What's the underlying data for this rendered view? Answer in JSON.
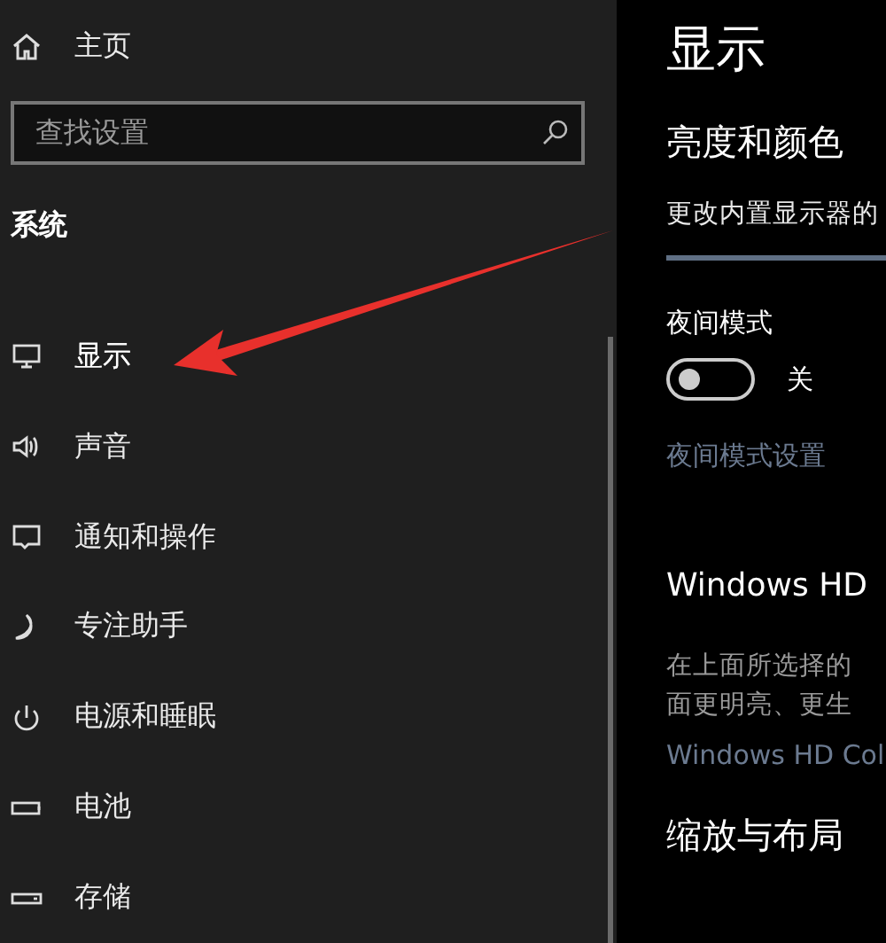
{
  "sidebar": {
    "home": {
      "label": "主页"
    },
    "search": {
      "placeholder": "查找设置"
    },
    "section_title": "系统",
    "items": [
      {
        "label": "显示",
        "selected": true
      },
      {
        "label": "声音",
        "selected": false
      },
      {
        "label": "通知和操作",
        "selected": false
      },
      {
        "label": "专注助手",
        "selected": false
      },
      {
        "label": "电源和睡眠",
        "selected": false
      },
      {
        "label": "电池",
        "selected": false
      },
      {
        "label": "存储",
        "selected": false
      }
    ]
  },
  "content": {
    "title": "显示",
    "brightness": {
      "heading": "亮度和颜色",
      "description": "更改内置显示器的"
    },
    "night_light": {
      "label": "夜间模式",
      "on": false,
      "state_text": "关",
      "settings_link": "夜间模式设置"
    },
    "hd_color": {
      "heading": "Windows HD",
      "description": [
        "在上面所选择的",
        "面更明亮、更生"
      ],
      "link": "Windows HD Col"
    },
    "next_heading": "缩放与布局"
  }
}
